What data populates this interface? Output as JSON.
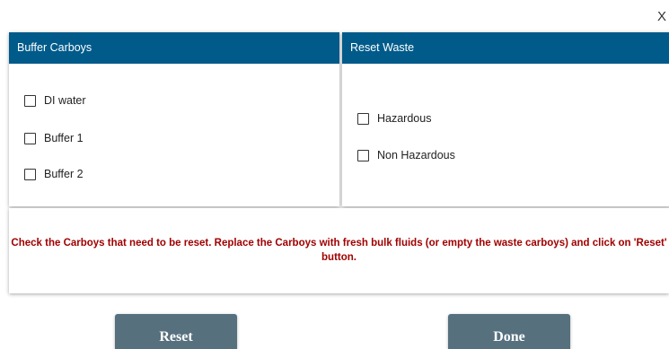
{
  "dialog": {
    "close_label": "X"
  },
  "buffer_panel": {
    "title": "Buffer Carboys",
    "items": [
      {
        "label": "DI water",
        "checked": false
      },
      {
        "label": "Buffer 1",
        "checked": false
      },
      {
        "label": "Buffer 2",
        "checked": false
      }
    ]
  },
  "waste_panel": {
    "title": "Reset Waste",
    "items": [
      {
        "label": "Hazardous",
        "checked": false
      },
      {
        "label": "Non Hazardous",
        "checked": false
      }
    ]
  },
  "message": {
    "text": "Check the Carboys that need to be reset. Replace the Carboys with fresh bulk fluids (or empty the waste carboys) and click on 'Reset' button."
  },
  "buttons": {
    "reset_label": "Reset",
    "done_label": "Done"
  },
  "colors": {
    "header_bg": "#005b8a",
    "button_bg": "#56707e",
    "message_text": "#a00000"
  }
}
